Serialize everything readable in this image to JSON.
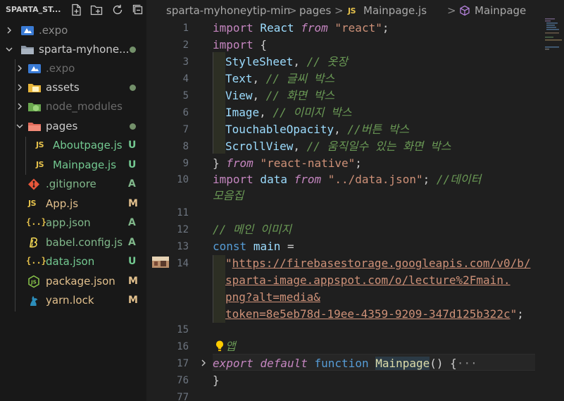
{
  "explorer": {
    "title": "SPARTA_ST...",
    "items": [
      {
        "label": ".expo",
        "status": "",
        "kind": "folder-closed",
        "dim": true
      },
      {
        "label": "sparta-myhone...",
        "status": "",
        "kind": "folder-open",
        "dim": false
      },
      {
        "label": ".expo",
        "status": "",
        "kind": "folder-closed",
        "dim": true
      },
      {
        "label": "assets",
        "status": "",
        "kind": "folder-closed",
        "dim": false
      },
      {
        "label": "node_modules",
        "status": "",
        "kind": "folder-closed",
        "dim": true
      },
      {
        "label": "pages",
        "status": "",
        "kind": "folder-open",
        "dim": false
      },
      {
        "label": "Aboutpage.js",
        "status": "U",
        "kind": "file",
        "dim": false
      },
      {
        "label": "Mainpage.js",
        "status": "U",
        "kind": "file",
        "dim": false
      },
      {
        "label": ".gitignore",
        "status": "A",
        "kind": "file",
        "dim": false
      },
      {
        "label": "App.js",
        "status": "M",
        "kind": "file",
        "dim": false
      },
      {
        "label": "app.json",
        "status": "A",
        "kind": "file",
        "dim": false
      },
      {
        "label": "babel.config.js",
        "status": "A",
        "kind": "file",
        "dim": false
      },
      {
        "label": "data.json",
        "status": "U",
        "kind": "file",
        "dim": false
      },
      {
        "label": "package.json",
        "status": "M",
        "kind": "file",
        "dim": false
      },
      {
        "label": "yarn.lock",
        "status": "M",
        "kind": "file",
        "dim": false
      }
    ]
  },
  "breadcrumb": {
    "segments": [
      "sparta-myhoneytip-min",
      "pages",
      "Mainpage.js",
      "Mainpage"
    ],
    "separator": ">"
  },
  "editor": {
    "line_numbers": [
      "1",
      "2",
      "3",
      "4",
      "5",
      "6",
      "7",
      "8",
      "9",
      "10",
      "",
      "11",
      "12",
      "13",
      "14",
      "",
      "",
      "",
      "15",
      "16",
      "17",
      "76",
      "77"
    ],
    "tokens": {
      "l1": [
        "import",
        " React ",
        "from",
        " ",
        "\"react\"",
        ";"
      ],
      "l2": [
        "import",
        " {"
      ],
      "l3": [
        "StyleSheet",
        ", ",
        "// 옷장"
      ],
      "l4": [
        "Text",
        ", ",
        "// 글씨 박스"
      ],
      "l5": [
        "View",
        ", ",
        "// 화면 박스"
      ],
      "l6": [
        "Image",
        ", ",
        "// 이미지 박스"
      ],
      "l7": [
        "TouchableOpacity",
        ", ",
        "//버튼 박스"
      ],
      "l8": [
        "ScrollView",
        ", ",
        "// 움직일수 있는 화면 박스"
      ],
      "l9": [
        "} ",
        "from",
        " ",
        "\"react-native\"",
        ";"
      ],
      "l10a": [
        "import",
        " data ",
        "from",
        " ",
        "\"../data.json\"",
        "; ",
        "//데이터"
      ],
      "l10b": "모음집",
      "l12": "// 메인 이미지",
      "l13": [
        "const",
        " ",
        "main",
        " ="
      ],
      "l14a": [
        "\"",
        "https://firebasestorage.googleapis.com/v0/b/"
      ],
      "l14b": "sparta-image.appspot.com/o/lecture%2Fmain.",
      "l14c": "png?alt=media&",
      "l14d": [
        "token=8e5eb78d-19ee-4359-9209-347d125b322c",
        "\"",
        ";"
      ],
      "l16": "앱",
      "l17": [
        "export",
        " ",
        "default",
        " ",
        "function",
        " ",
        "Mainpage",
        "()",
        " {",
        "···"
      ],
      "l76": "}"
    }
  },
  "colors": {
    "keyword": "#569cd6",
    "control": "#c586c0",
    "string": "#ce9178",
    "comment": "#6a9955",
    "function": "#dcdcaa",
    "variable": "#9cdcfe",
    "status_untracked": "#73c991",
    "status_modified": "#e2c08d",
    "status_added": "#81b88b"
  },
  "icons": {
    "new_file": "new-file-icon",
    "new_folder": "new-folder-icon",
    "refresh": "refresh-icon",
    "collapse": "collapse-all-icon",
    "lightbulb": "lightbulb-icon",
    "image_preview": "image-preview-icon"
  }
}
